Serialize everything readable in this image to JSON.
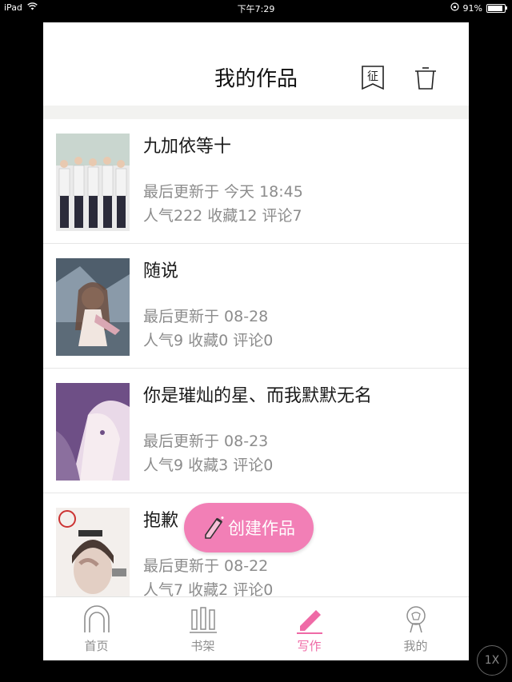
{
  "status_bar": {
    "device": "iPad",
    "time": "下午7:29",
    "battery": "91%"
  },
  "header": {
    "title": "我的作品",
    "zheng_label": "征"
  },
  "works": [
    {
      "title": "九加依等十",
      "updated": "最后更新于 今天 18:45",
      "stats": "人气222  收藏12  评论7",
      "cover_colors": [
        "#c8d9c2",
        "#e8e8e8"
      ]
    },
    {
      "title": "随说",
      "updated": "最后更新于 08-28",
      "stats": "人气9  收藏0  评论0",
      "cover_colors": [
        "#5a6f86",
        "#cfd7de"
      ]
    },
    {
      "title": "你是璀灿的星、而我默默无名",
      "updated": "最后更新于 08-23",
      "stats": "人气9  收藏3  评论0",
      "cover_colors": [
        "#6b4f7d",
        "#e9d8e6"
      ]
    },
    {
      "title": "抱歉",
      "updated": "最后更新于 08-22",
      "stats": "人气7  收藏2  评论0",
      "cover_colors": [
        "#f1ece8",
        "#c9b5a9"
      ]
    }
  ],
  "fab": {
    "label": "创建作品"
  },
  "tabbar": {
    "tabs": [
      {
        "label": "首页",
        "icon": "home-arch-icon"
      },
      {
        "label": "书架",
        "icon": "bookshelf-icon"
      },
      {
        "label": "写作",
        "icon": "pencil-icon"
      },
      {
        "label": "我的",
        "icon": "profile-icon"
      }
    ],
    "active_index": 2,
    "active_color": "#ef6aa6"
  },
  "zoom_badge": "1X"
}
